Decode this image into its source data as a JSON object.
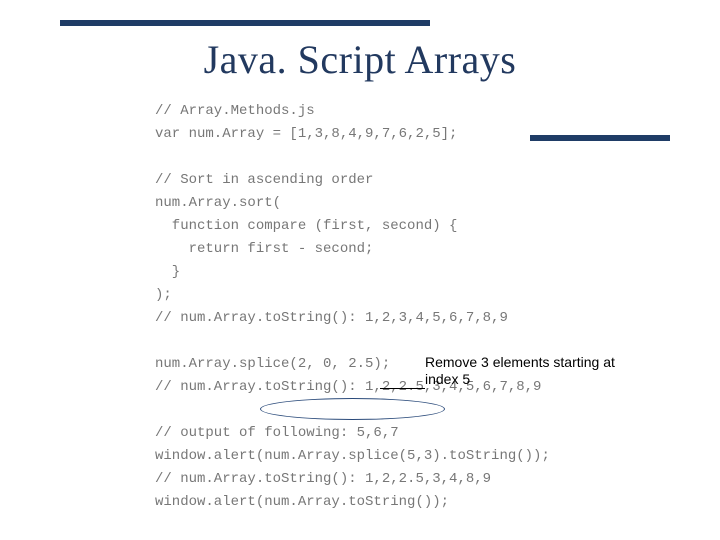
{
  "title": "Java. Script Arrays",
  "code": {
    "l1": "// Array.Methods.js",
    "l2": "var num.Array = [1,3,8,4,9,7,6,2,5];",
    "l3": "",
    "l4": "// Sort in ascending order",
    "l5": "num.Array.sort(",
    "l6": "  function compare (first, second) {",
    "l7": "    return first - second;",
    "l8": "  }",
    "l9": ");",
    "l10": "// num.Array.toString(): 1,2,3,4,5,6,7,8,9",
    "l11": "",
    "l12": "num.Array.splice(2, 0, 2.5);",
    "l13": "// num.Array.toString(): 1,2,2.5,3,4,5,6,7,8,9",
    "l14": "",
    "l15": "// output of following: 5,6,7",
    "l16": "window.alert(num.Array.splice(5,3).toString());",
    "l17": "// num.Array.toString(): 1,2,2.5,3,4,8,9",
    "l18": "window.alert(num.Array.toString());"
  },
  "annotation": "Remove 3 elements starting at index 5"
}
